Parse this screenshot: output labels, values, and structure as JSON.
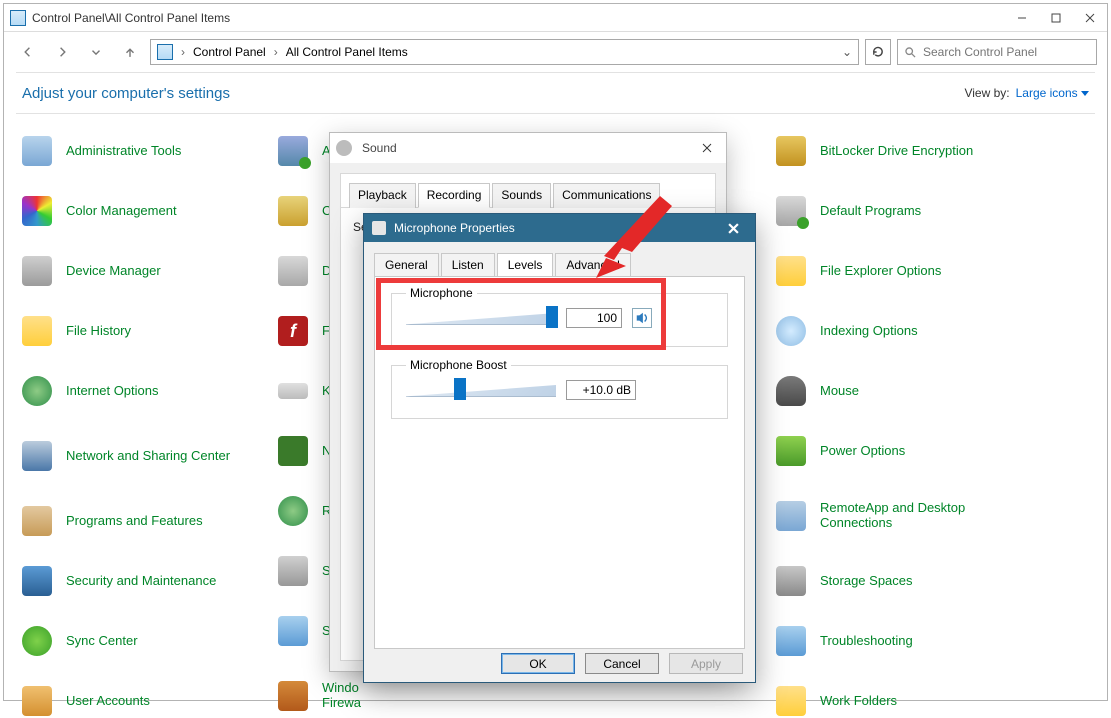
{
  "window": {
    "title": "Control Panel\\All Control Panel Items"
  },
  "breadcrumb": {
    "a": "Control Panel",
    "b": "All Control Panel Items"
  },
  "search": {
    "placeholder": "Search Control Panel"
  },
  "heading": "Adjust your computer's settings",
  "view": {
    "label": "View by:",
    "value": "Large icons"
  },
  "col1": {
    "i0": "Administrative Tools",
    "i1": "Color Management",
    "i2": "Device Manager",
    "i3": "File History",
    "i4": "Internet Options",
    "i5": "Network and Sharing Center",
    "i6": "Programs and Features",
    "i7": "Security and Maintenance",
    "i8": "Sync Center",
    "i9": "User Accounts"
  },
  "col2": {
    "i0": "A",
    "i1": "C",
    "i2": "D",
    "i3": "Fl",
    "i4": "Ke",
    "i5": "N",
    "i6": "Re",
    "i7": "Sc",
    "i8": "Sy",
    "i9a": "Windo",
    "i9b": "Firewa"
  },
  "col3": {
    "i0": "BitLocker Drive Encryption",
    "i1": "Default Programs",
    "i2": "File Explorer Options",
    "i3": "Indexing Options",
    "i4": "Mouse",
    "i5": "Power Options",
    "i6": "RemoteApp and Desktop Connections",
    "i7": "Storage Spaces",
    "i8": "Troubleshooting",
    "i9": "Work Folders"
  },
  "sound": {
    "title": "Sound",
    "tabs": {
      "playback": "Playback",
      "recording": "Recording",
      "sounds": "Sounds",
      "comm": "Communications"
    },
    "body": "Sel"
  },
  "mic": {
    "title": "Microphone Properties",
    "tabs": {
      "general": "General",
      "listen": "Listen",
      "levels": "Levels",
      "advanced": "Advanced"
    },
    "microphone": {
      "label": "Microphone",
      "value": "100"
    },
    "boost": {
      "label": "Microphone Boost",
      "value": "+10.0 dB"
    },
    "buttons": {
      "ok": "OK",
      "cancel": "Cancel",
      "apply": "Apply"
    }
  }
}
